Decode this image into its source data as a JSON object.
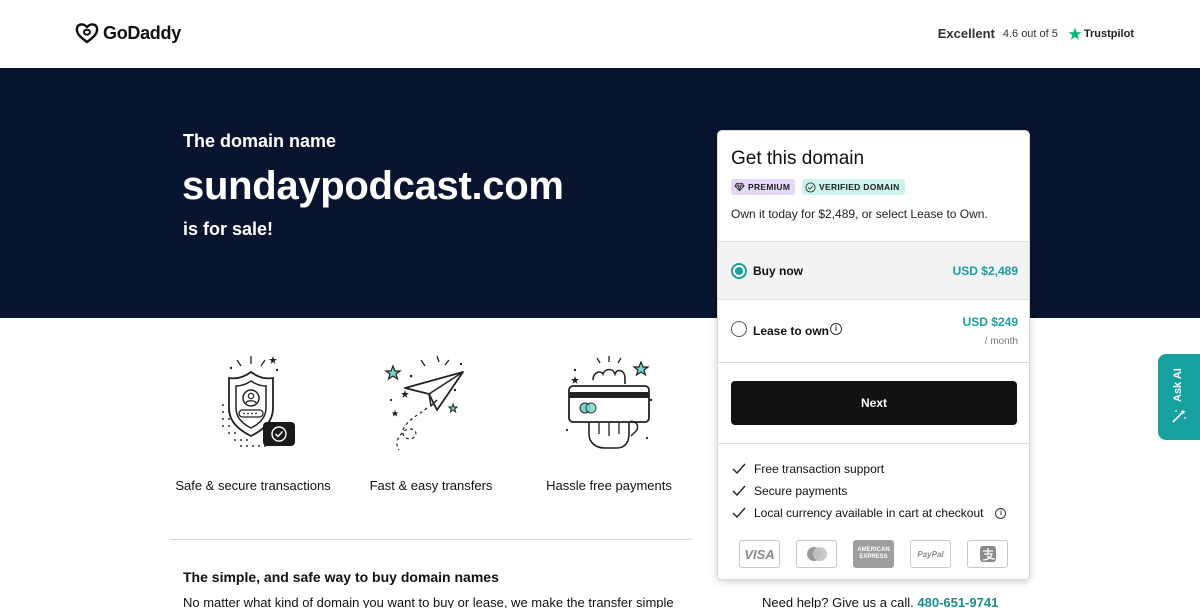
{
  "header": {
    "logo_text": "GoDaddy",
    "trustpilot": {
      "rating_word": "Excellent",
      "rating_text": "4.6 out of 5",
      "brand": "Trustpilot",
      "star_color": "#00b67a"
    }
  },
  "hero": {
    "pre_text": "The domain name",
    "domain": "sundaypodcast.com",
    "post_text": "is for sale!",
    "background": "#09152e"
  },
  "features": [
    {
      "label": "Safe & secure transactions",
      "icon": "shield-user-icon"
    },
    {
      "label": "Fast & easy transfers",
      "icon": "paper-plane-icon"
    },
    {
      "label": "Hassle free payments",
      "icon": "hand-card-icon"
    }
  ],
  "info": {
    "title": "The simple, and safe way to buy domain names",
    "body": "No matter what kind of domain you want to buy or lease, we make the transfer simple"
  },
  "help": {
    "text": "Need help? Give us a call.",
    "phone": "480-651-9741"
  },
  "card": {
    "title": "Get this domain",
    "badges": {
      "premium": "PREMIUM",
      "verified": "VERIFIED DOMAIN"
    },
    "description": "Own it today for $2,489, or select Lease to Own.",
    "options": {
      "buy": {
        "label": "Buy now",
        "price": "USD $2,489",
        "selected": true
      },
      "lease": {
        "label": "Lease to own",
        "price": "USD $249",
        "sub": "/ month",
        "selected": false
      }
    },
    "next_label": "Next",
    "perks": [
      "Free transaction support",
      "Secure payments",
      "Local currency available in cart at checkout"
    ],
    "payment_methods": [
      "VISA",
      "mastercard-icon",
      "AMERICAN EXPRESS",
      "PayPal",
      "alipay-icon"
    ],
    "accent_color": "#1b9e9e"
  },
  "askai": {
    "label": "Ask AI",
    "color": "#17a0a0"
  }
}
